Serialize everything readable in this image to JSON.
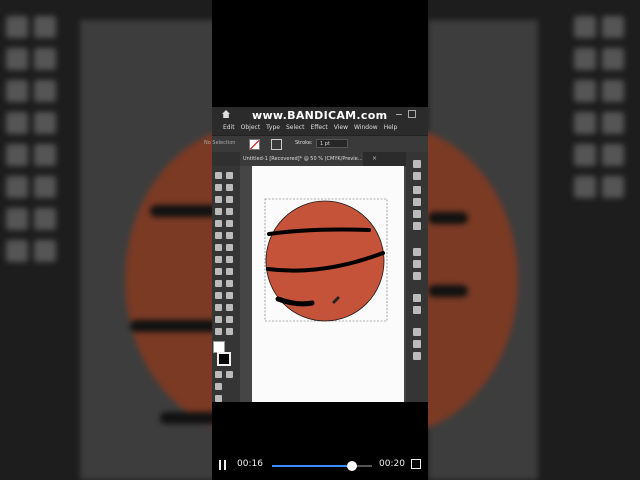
{
  "watermark": "www.BANDICAM.com",
  "menu": [
    "File",
    "Edit",
    "Object",
    "Type",
    "Select",
    "Effect",
    "View",
    "Window",
    "Help"
  ],
  "control_bar": {
    "selection_label": "No Selection",
    "stroke_label": "Stroke:",
    "stroke_value": "1 pt"
  },
  "document_tab": "Untitled-1 [Recovered]* @ 50 % (CMYK/Previe...",
  "colors": {
    "ball": "#c5533a",
    "ball_outline": "#1a1a1a",
    "stripe": "#000000",
    "accent": "#3b8cff"
  },
  "player": {
    "current_time": "00:16",
    "total_time": "00:20",
    "progress": 0.8
  }
}
